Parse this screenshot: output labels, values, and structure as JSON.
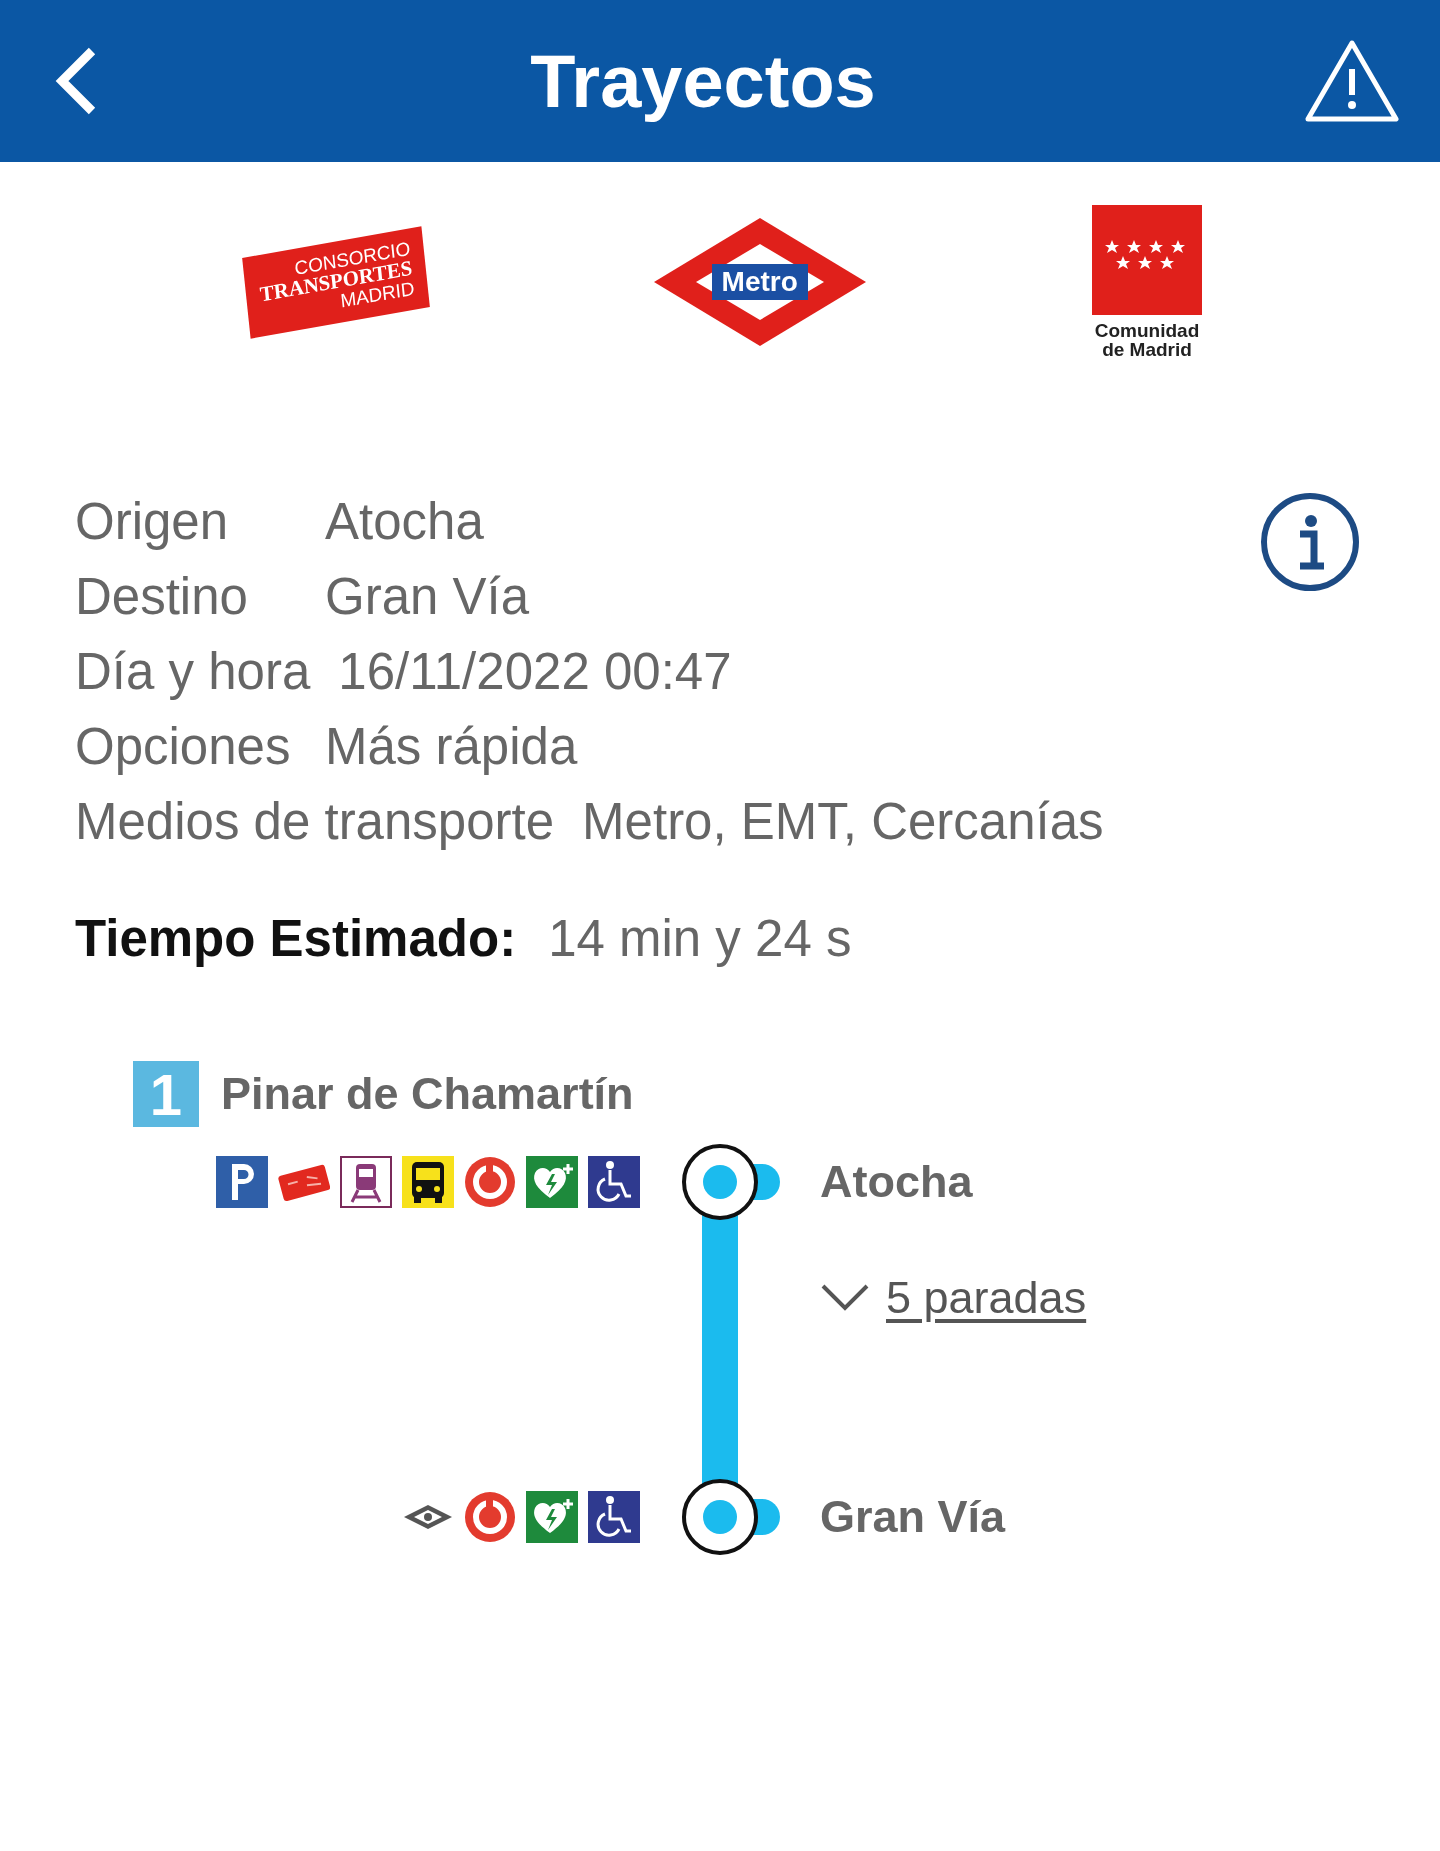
{
  "header": {
    "title": "Trayectos"
  },
  "logos": [
    {
      "kind": "consorcio",
      "lines": [
        "CONSORCIO",
        "TRANSPORTES",
        "MADRID"
      ]
    },
    {
      "kind": "metro",
      "lines": [
        "Metro"
      ]
    },
    {
      "kind": "comunidad",
      "lines": [
        "Comunidad",
        "de Madrid"
      ]
    }
  ],
  "trip": [
    {
      "label": "Origen",
      "value": "Atocha"
    },
    {
      "label": "Destino",
      "value": "Gran Vía"
    },
    {
      "label": "Día y hora",
      "value": "16/11/2022 00:47"
    },
    {
      "label": "Opciones",
      "value": "Más rápida"
    },
    {
      "label": "Medios de transporte",
      "value": "Metro, EMT, Cercanías"
    }
  ],
  "estimate": {
    "label": "Tiempo Estimado:",
    "value": "14 min y 24 s"
  },
  "route": {
    "line": {
      "number": "1",
      "direction": "Pinar de Chamartín"
    },
    "stops": [
      {
        "name": "Atocha",
        "services": [
          {
            "kind": "parking"
          },
          {
            "kind": "card"
          },
          {
            "kind": "train"
          },
          {
            "kind": "bus"
          },
          {
            "kind": "cercanias"
          },
          {
            "kind": "defibrillator"
          },
          {
            "kind": "accessible"
          }
        ]
      },
      {
        "name": "Gran Vía",
        "services": [
          {
            "kind": "light-rail"
          },
          {
            "kind": "cercanias"
          },
          {
            "kind": "defibrillator"
          },
          {
            "kind": "accessible"
          }
        ]
      }
    ],
    "toggle": {
      "label": "5 paradas",
      "expanded": false
    }
  }
}
